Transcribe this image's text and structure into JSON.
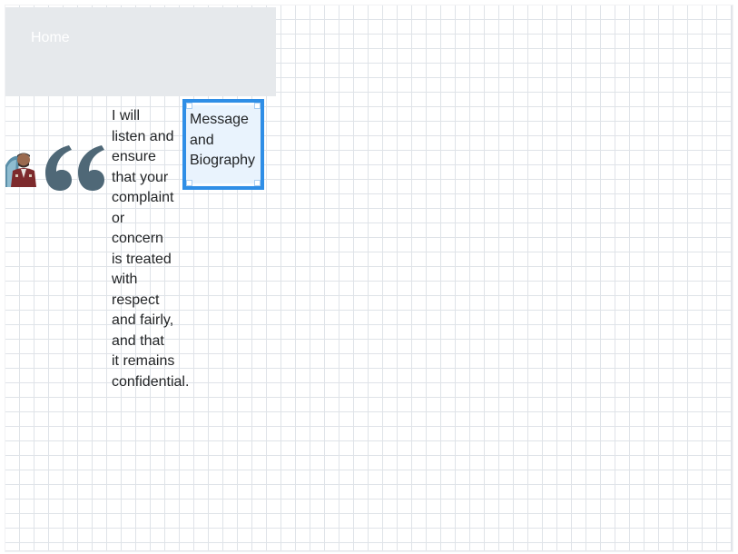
{
  "nav": {
    "home_label": "Home"
  },
  "hero": {
    "avatar_icon": "person-portrait-icon",
    "quote_icon": "open-quote-icon",
    "message_lines": [
      "I will",
      "listen and",
      "ensure",
      "that your",
      "complaint",
      "or",
      "concern",
      "is treated",
      "with",
      "respect",
      "and fairly,",
      "and that",
      "it remains",
      "confidential."
    ]
  },
  "selection": {
    "label_lines": [
      "Message",
      "and",
      "Biography"
    ]
  },
  "colors": {
    "nav_background": "#e6e9ec",
    "quote_color": "#4f6877",
    "selection_border": "#2f8ee6",
    "selection_fill": "#e9f3fd",
    "text": "#222426"
  }
}
